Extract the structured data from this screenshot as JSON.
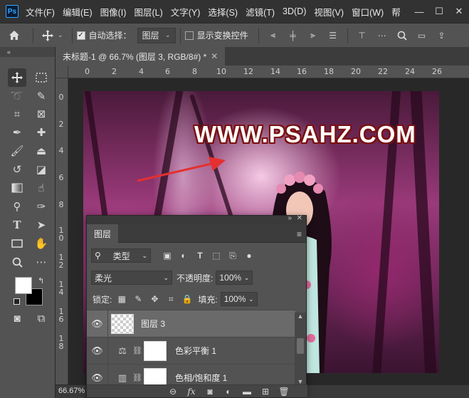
{
  "app": {
    "logo": "Ps",
    "menu": [
      "文件(F)",
      "编辑(E)",
      "图像(I)",
      "图层(L)",
      "文字(Y)",
      "选择(S)",
      "滤镜(T)",
      "3D(D)",
      "视图(V)",
      "窗口(W)",
      "帮"
    ],
    "window_controls": [
      "—",
      "☐",
      "✕"
    ]
  },
  "options": {
    "auto_select_label": "自动选择：",
    "auto_select_target": "图层",
    "show_transform_label": "显示变换控件"
  },
  "document": {
    "tab_title": "未标题-1 @ 66.7% (图层 3, RGB/8#) *",
    "tab_close": "✕",
    "zoom": "66.67%",
    "watermark": "WWW.PSAHZ.COM"
  },
  "rulers": {
    "horizontal": [
      "0",
      "2",
      "4",
      "6",
      "8",
      "10",
      "12",
      "14",
      "16",
      "18",
      "20",
      "22",
      "24",
      "26"
    ],
    "vertical": [
      "0",
      "2",
      "4",
      "6",
      "8",
      "1\n0",
      "1\n2",
      "1\n4",
      "1\n6",
      "1\n8"
    ]
  },
  "layers_panel": {
    "tab_label": "图层",
    "filter_kind": "类型",
    "blend_mode": "柔光",
    "opacity_label": "不透明度:",
    "opacity_value": "100%",
    "lock_label": "锁定:",
    "fill_label": "填充:",
    "fill_value": "100%",
    "layers": [
      {
        "name": "图层 3",
        "selected": true,
        "type": "pixel"
      },
      {
        "name": "色彩平衡 1",
        "selected": false,
        "type": "adjustment"
      },
      {
        "name": "色相/饱和度 1",
        "selected": false,
        "type": "adjustment"
      }
    ],
    "bottom_icons": [
      "link-icon",
      "fx-icon",
      "mask-icon",
      "adjustment-icon",
      "folder-icon",
      "new-layer-icon",
      "trash-icon"
    ]
  },
  "colors": {
    "accent": "#31a8ff",
    "foreground": "#ffffff",
    "background": "#000000",
    "arrow": "#e53030"
  }
}
